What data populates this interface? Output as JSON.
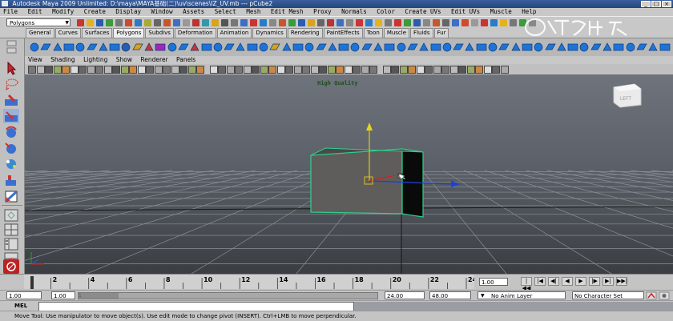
{
  "window": {
    "title": "Autodesk Maya 2009 Unlimited: D:\\maya\\MAYA基础(二)\\uv\\scenes\\IZ_UV.mb  ---  pCube2",
    "buttons": [
      "_",
      "□",
      "×"
    ]
  },
  "menubar": [
    "File",
    "Edit",
    "Modify",
    "Create",
    "Display",
    "Window",
    "Assets",
    "Select",
    "Mesh",
    "Edit Mesh",
    "Proxy",
    "Normals",
    "Color",
    "Create UVs",
    "Edit UVs",
    "Muscle",
    "Help"
  ],
  "status_line": {
    "mode": "Polygons",
    "icon_colors": [
      "#c33",
      "#e6b21c",
      "#2a5db0",
      "#3a9c3a",
      "#777",
      "#d04a2a",
      "#2b7bc9",
      "#aa3",
      "#666",
      "#c8562b",
      "#3d6fc4",
      "#999",
      "#b33",
      "#39a",
      "#d9a41a",
      "#555",
      "#777",
      "#3d6fc4",
      "#c33",
      "#2b7bc9",
      "#888",
      "#c8562b",
      "#3a9c3a",
      "#2a5db0",
      "#d9a41a",
      "#666",
      "#b33",
      "#3d6fc4",
      "#888",
      "#c33",
      "#2b7bc9",
      "#e6b21c",
      "#777",
      "#c33",
      "#3a9c3a",
      "#2a5db0",
      "#888",
      "#c8562b",
      "#666",
      "#3d6fc4",
      "#d04a2a",
      "#999",
      "#c33",
      "#2b7bc9",
      "#e6b21c",
      "#777",
      "#3a9c3a",
      "#888"
    ]
  },
  "shelf": {
    "tabs": [
      "General",
      "Curves",
      "Surfaces",
      "Polygons",
      "Subdivs",
      "Deformation",
      "Animation",
      "Dynamics",
      "Rendering",
      "PaintEffects",
      "Toon",
      "Muscle",
      "Fluids",
      "Fur"
    ],
    "active_tab": "Polygons",
    "icon_colors": [
      "#1e74d6",
      "#1e74d6",
      "#1e74d6",
      "#1e74d6",
      "#1e74d6",
      "#1e74d6",
      "#1e74d6",
      "#1e74d6",
      "#2a5db0",
      "#d8a21a",
      "#c33",
      "#9a2ab5",
      "#1e74d6",
      "#1e74d6",
      "#c33",
      "#1e74d6",
      "#1e74d6",
      "#1e74d6",
      "#1e74d6",
      "#1e74d6",
      "#1e74d6",
      "#d8a21a",
      "#1e74d6",
      "#1e74d6",
      "#1e74d6",
      "#1e74d6",
      "#1e74d6",
      "#1e74d6",
      "#1e74d6",
      "#1e74d6",
      "#1e74d6",
      "#1e74d6",
      "#1e74d6",
      "#1e74d6",
      "#1e74d6",
      "#1e74d6",
      "#1e74d6",
      "#1e74d6",
      "#1e74d6",
      "#1e74d6",
      "#1e74d6",
      "#1e74d6",
      "#1e74d6",
      "#1e74d6",
      "#1e74d6",
      "#1e74d6",
      "#1e74d6",
      "#1e74d6",
      "#1e74d6",
      "#1e74d6",
      "#1e74d6",
      "#1e74d6",
      "#1e74d6",
      "#1e74d6",
      "#1e74d6",
      "#1e74d6"
    ]
  },
  "toolbox": [
    "select-tool",
    "lasso-tool",
    "paint-select-tool",
    "move-tool",
    "rotate-tool",
    "scale-tool",
    "soft-mod-tool",
    "show-manipulator-tool",
    "last-used-tool",
    "single-perspective-layout",
    "four-view-layout",
    "outliner-layout",
    "graph-editor-layout",
    "hypershade-layout"
  ],
  "panel": {
    "menu": [
      "View",
      "Shading",
      "Lighting",
      "Show",
      "Renderer",
      "Panels"
    ],
    "viewport_label": "High Quality",
    "view_cube_label": "LEFT",
    "toolbar_icon_count": 56
  },
  "timeline": {
    "ticks": [
      "2",
      "4",
      "6",
      "8",
      "10",
      "12",
      "14",
      "16",
      "18",
      "20",
      "22",
      "24"
    ],
    "tick_values": [
      2,
      4,
      6,
      8,
      10,
      12,
      14,
      16,
      18,
      20,
      22,
      24
    ],
    "current_frame": "1.00",
    "playback_buttons": [
      "|◀◀",
      "|◀",
      "◀|",
      "◀",
      "▶",
      "|▶",
      "▶|",
      "▶▶|"
    ]
  },
  "range": {
    "start": "1.00",
    "playback_start": "1.00",
    "handle_label": "1",
    "playback_end": "24.00",
    "end": "48.00",
    "anim_layer": "No Anim Layer",
    "character_set": "No Character Set"
  },
  "mel": {
    "label": "MEL"
  },
  "help_line": "Move Tool: Use manipulator to move object(s). Use edit mode to change pivot (INSERT). Ctrl+LMB to move perpendicular."
}
